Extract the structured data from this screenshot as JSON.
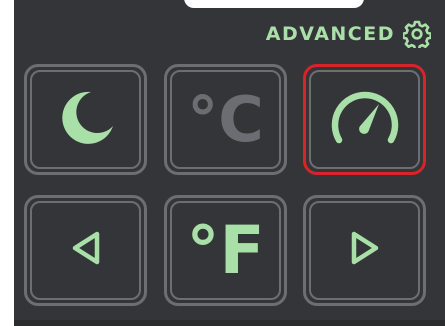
{
  "header": {
    "label": "ADVANCED",
    "icon": "gear-icon"
  },
  "colors": {
    "background": "#333538",
    "accent": "#a9e0a7",
    "inactive": "#6c6d72",
    "selected_border": "#d9232a"
  },
  "tiles": [
    {
      "id": "night-mode",
      "icon": "moon-icon",
      "label": "",
      "state": "active",
      "selected": false
    },
    {
      "id": "celsius",
      "icon": "",
      "label": "°C",
      "state": "inactive",
      "selected": false
    },
    {
      "id": "speedometer",
      "icon": "gauge-icon",
      "label": "",
      "state": "active",
      "selected": true
    },
    {
      "id": "left",
      "icon": "triangle-left-icon",
      "label": "",
      "state": "active",
      "selected": false
    },
    {
      "id": "fahrenheit",
      "icon": "",
      "label": "°F",
      "state": "active",
      "selected": false
    },
    {
      "id": "right",
      "icon": "triangle-right-icon",
      "label": "",
      "state": "active",
      "selected": false
    }
  ]
}
